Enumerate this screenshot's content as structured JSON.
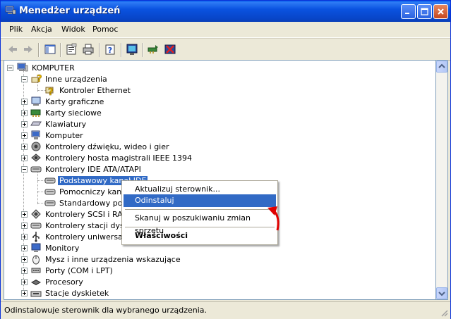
{
  "window": {
    "title": "Menedżer urządzeń",
    "controls": [
      "minimize-icon",
      "maximize-icon",
      "close-icon"
    ]
  },
  "menubar": {
    "items": [
      {
        "label": "Plik"
      },
      {
        "label": "Akcja"
      },
      {
        "label": "Widok"
      },
      {
        "label": "Pomoc"
      }
    ]
  },
  "toolbar": {
    "buttons": [
      "back-arrow-icon",
      "forward-arrow-icon",
      "console-tree-icon",
      "properties-icon",
      "print-icon",
      "help-icon",
      "scan-hardware-icon",
      "update-driver-icon",
      "uninstall-icon"
    ]
  },
  "tree": {
    "root": "KOMPUTER",
    "items": [
      {
        "label": "Inne urządzenia",
        "icon": "unknown-device-icon",
        "expanded": true
      },
      {
        "label": "Kontroler Ethernet",
        "icon": "warning-device-icon"
      },
      {
        "label": "Karty graficzne",
        "icon": "display-adapter-icon"
      },
      {
        "label": "Karty sieciowe",
        "icon": "network-card-icon"
      },
      {
        "label": "Klawiatury",
        "icon": "keyboard-icon"
      },
      {
        "label": "Komputer",
        "icon": "computer-icon"
      },
      {
        "label": "Kontrolery dźwięku, wideo i gier",
        "icon": "sound-icon"
      },
      {
        "label": "Kontrolery hosta magistrali IEEE 1394",
        "icon": "firewire-icon"
      },
      {
        "label": "Kontrolery IDE ATA/ATAPI",
        "icon": "ide-controller-icon",
        "expanded": true
      },
      {
        "label": "Podstawowy kanał IDE",
        "icon": "ide-channel-icon",
        "selected": true
      },
      {
        "label": "Pomocniczy kanał IDE",
        "icon": "ide-channel-icon"
      },
      {
        "label": "Standardowy podwójny kontroler IDE",
        "icon": "ide-channel-icon"
      },
      {
        "label": "Kontrolery SCSI i RAID",
        "icon": "scsi-icon"
      },
      {
        "label": "Kontrolery stacji dysków",
        "icon": "floppy-controller-icon"
      },
      {
        "label": "Kontrolery uniwersalnej magistrali szeregowej",
        "icon": "usb-icon"
      },
      {
        "label": "Monitory",
        "icon": "monitor-icon"
      },
      {
        "label": "Mysz i inne urządzenia wskazujące",
        "icon": "mouse-icon"
      },
      {
        "label": "Porty (COM i LPT)",
        "icon": "port-icon"
      },
      {
        "label": "Procesory",
        "icon": "processor-icon"
      },
      {
        "label": "Stacje dyskietek",
        "icon": "floppy-drive-icon"
      }
    ]
  },
  "context_menu": {
    "items": [
      {
        "label": "Aktualizuj sterownik..."
      },
      {
        "label": "Odinstaluj",
        "highlighted": true
      },
      {
        "label": "Skanuj w poszukiwaniu zmian sprzętu"
      },
      {
        "label": "Właściwości",
        "bold": true
      }
    ]
  },
  "statusbar": {
    "text": "Odinstalowuje sterownik dla wybranego urządzenia."
  },
  "colors": {
    "title_blue": "#0A53E0",
    "selection": "#316AC5",
    "annotation_arrow": "#E00000"
  }
}
